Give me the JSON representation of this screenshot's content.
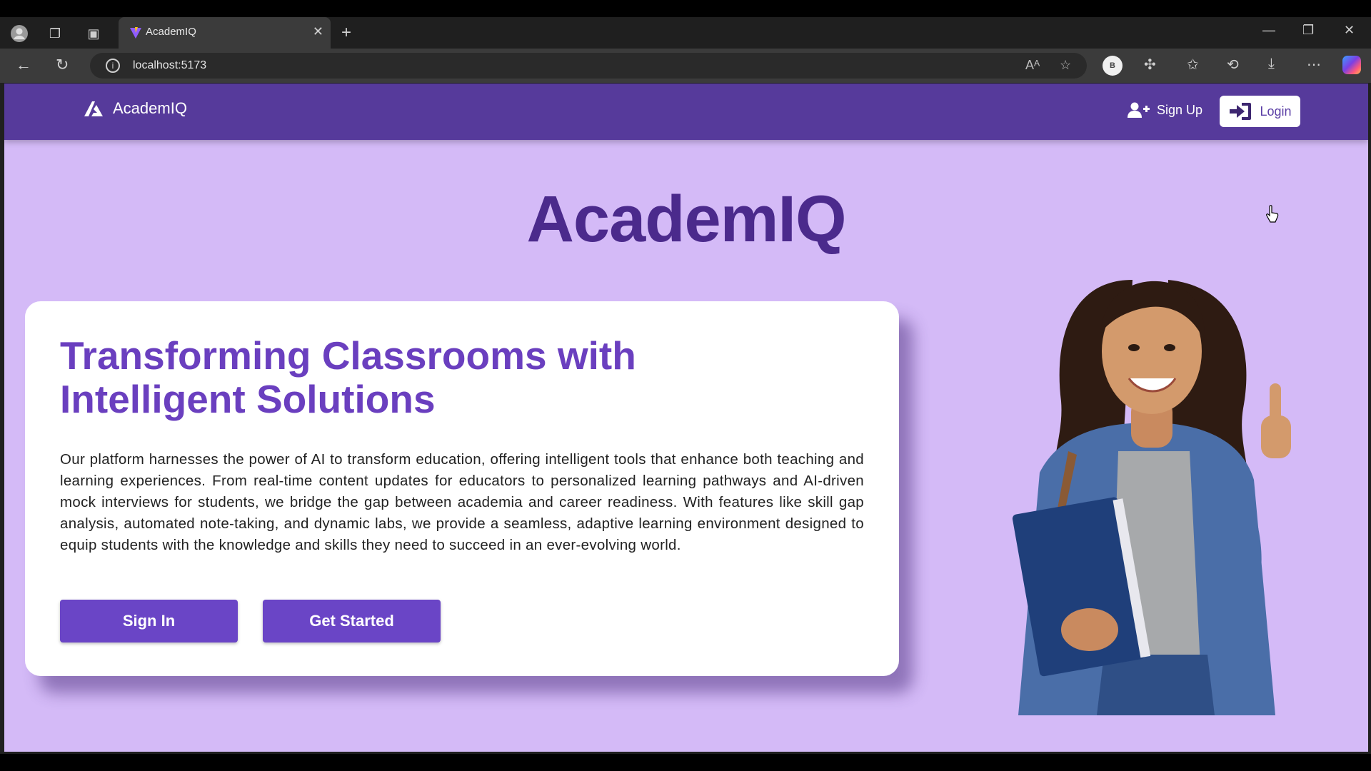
{
  "browser": {
    "tab_title": "AcademIQ",
    "url": "localhost:5173",
    "profile_initial": "B"
  },
  "header": {
    "brand": "AcademIQ",
    "signup_label": "Sign Up",
    "login_label": "Login"
  },
  "hero": {
    "title": "AcademIQ"
  },
  "card": {
    "heading": "Transforming Classrooms with Intelligent Solutions",
    "body": "Our platform harnesses the power of AI to transform education, offering intelligent tools that enhance both teaching and learning experiences. From real-time content updates for educators to personalized learning pathways and AI-driven mock interviews for students, we bridge the gap between academia and career readiness. With features like skill gap analysis, automated note-taking, and dynamic labs, we provide a seamless, adaptive learning environment designed to equip students with the knowledge and skills they need to succeed in an ever-evolving world.",
    "sign_in_label": "Sign In",
    "get_started_label": "Get Started"
  },
  "colors": {
    "header_bg": "#563a9b",
    "page_bg": "#d4baf7",
    "accent": "#6a45c6",
    "title": "#4b2a8c"
  }
}
